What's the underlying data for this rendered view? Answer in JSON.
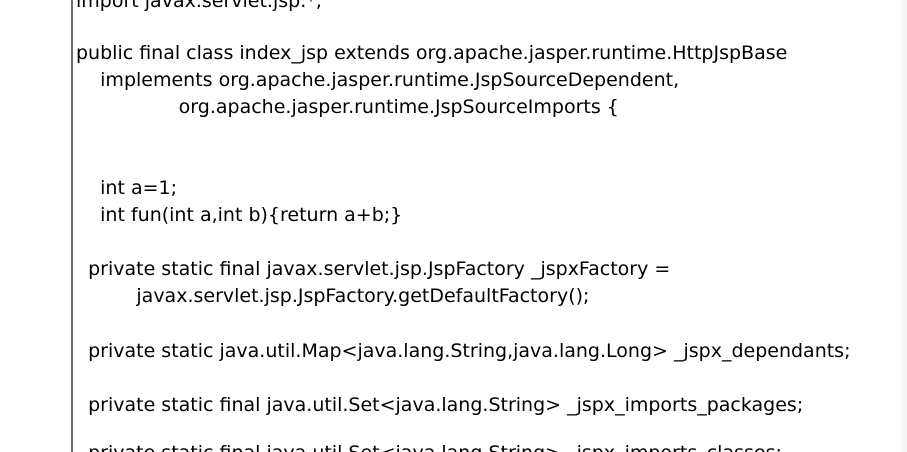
{
  "editor": {
    "lines": [
      "import javax.servlet.jsp.*;",
      "public final class index_jsp extends org.apache.jasper.runtime.HttpJspBase",
      "    implements org.apache.jasper.runtime.JspSourceDependent,",
      "                 org.apache.jasper.runtime.JspSourceImports {",
      "    int a=1;",
      "    int fun(int a,int b){return a+b;}",
      "  private static final javax.servlet.jsp.JspFactory _jspxFactory =",
      "          javax.servlet.jsp.JspFactory.getDefaultFactory();",
      "  private static java.util.Map<java.lang.String,java.lang.Long> _jspx_dependants;",
      "  private static final java.util.Set<java.lang.String> _jspx_imports_packages;",
      "  private static final java.util.Set<java.lang.String> _jspx_imports_classes;"
    ]
  }
}
